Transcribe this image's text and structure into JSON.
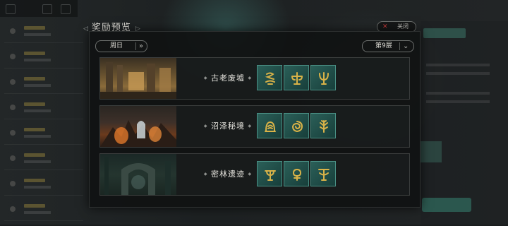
{
  "panel": {
    "title": "奖励预览",
    "close_label": "关闭",
    "day_selector": "周日",
    "floor_selector": "第9层"
  },
  "dungeons": [
    {
      "name": "古老废墟",
      "icons": [
        "curl-rune-icon",
        "balance-rune-icon",
        "trident-rune-icon"
      ]
    },
    {
      "name": "沼泽秘境",
      "icons": [
        "arch-rune-icon",
        "spiral-rune-icon",
        "branch-rune-icon"
      ]
    },
    {
      "name": "密林遗迹",
      "icons": [
        "fork-rune-icon",
        "bulb-rune-icon",
        "anchor-rune-icon"
      ]
    }
  ],
  "colors": {
    "icon_bg": "#1f4b46",
    "icon_border": "#4a8f84",
    "rune_gold": "#d8b248",
    "close_x": "#c83a3a"
  }
}
